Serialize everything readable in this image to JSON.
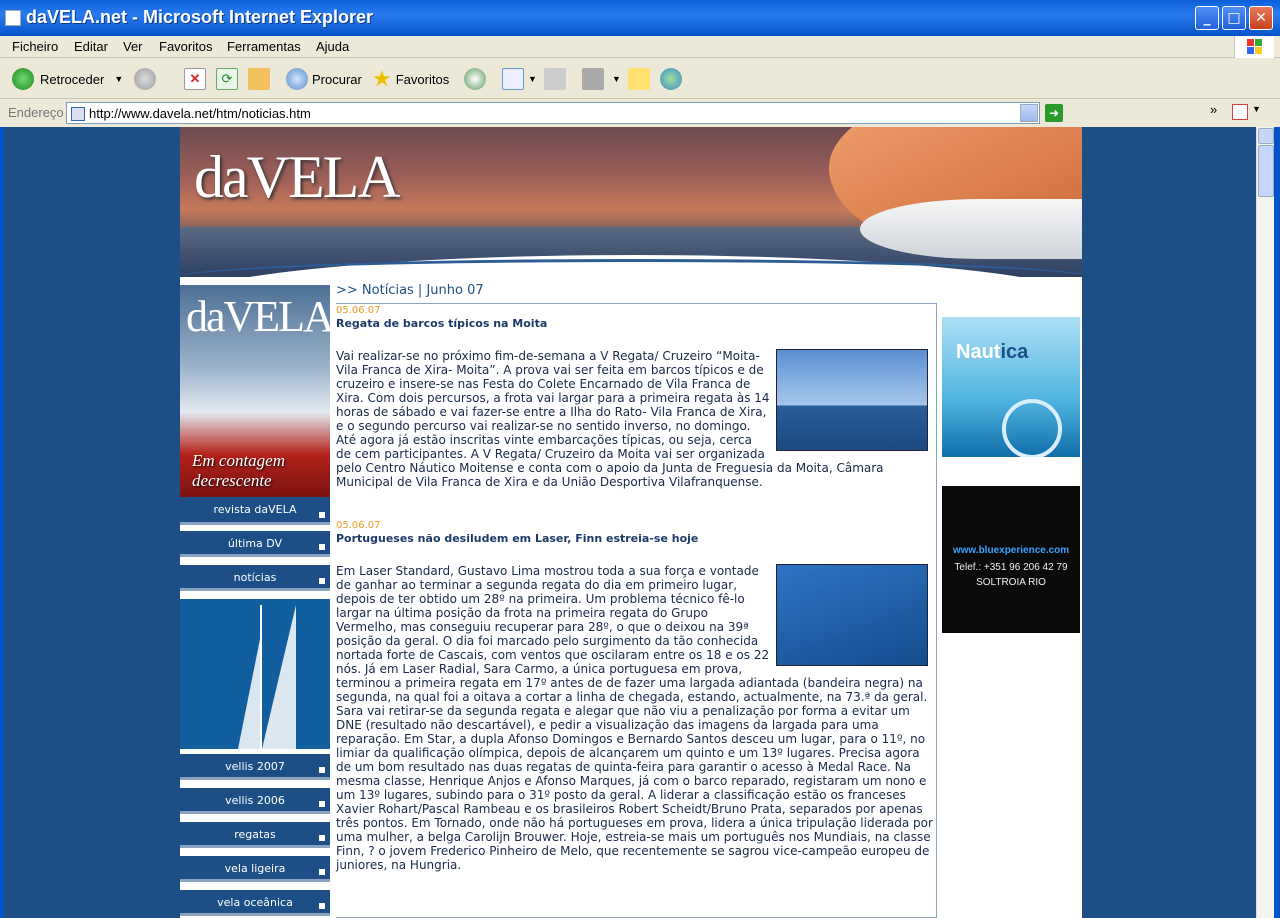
{
  "window": {
    "title": "daVELA.net - Microsoft Internet Explorer",
    "minimize": "_",
    "maximize": "□",
    "close": "✕"
  },
  "menu": [
    "Ficheiro",
    "Editar",
    "Ver",
    "Favoritos",
    "Ferramentas",
    "Ajuda"
  ],
  "toolbar": {
    "back": "Retroceder",
    "search": "Procurar",
    "favorites": "Favoritos"
  },
  "address": {
    "label": "Endereço",
    "url": "http://www.davela.net/htm/noticias.htm"
  },
  "site": {
    "logo": "daVELA",
    "cover_logo": "daVELA",
    "cover_tagline": "Em contagem decrescente",
    "nav": [
      "revista daVELA",
      "última DV",
      "notícias",
      "vellis 2007",
      "vellis 2006",
      "regatas",
      "vela ligeira",
      "vela oceânica"
    ],
    "heading": ">> Notícias | Junho 07",
    "articles": [
      {
        "date": "05.06.07",
        "title": "Regata de barcos típicos na Moita",
        "body": "Vai realizar-se no próximo fim-de-semana a V Regata/ Cruzeiro “Moita- Vila Franca de Xira- Moita”. A prova vai ser feita em barcos típicos e de cruzeiro e insere-se nas Festa do Colete Encarnado de Vila Franca de Xira. Com dois percursos, a frota vai largar para a primeira regata às 14 horas de sábado e vai fazer-se entre a Ilha do Rato- Vila Franca de Xira, e o segundo percurso vai realizar-se no sentido inverso, no domingo. Até agora já estão inscritas vinte embarcações típicas, ou seja, cerca de cem participantes. A V Regata/ Cruzeiro da Moita vai ser organizada pelo Centro Náutico Moitense e conta com o apoio da Junta de Freguesia da Moita, Câmara Municipal de Vila Franca de Xira e da União Desportiva Vilafranquense."
      },
      {
        "date": "05.06.07",
        "title": "Portugueses não desiludem em Laser, Finn estreia-se hoje",
        "body": "Em Laser Standard, Gustavo Lima mostrou toda a sua força e vontade de ganhar ao terminar a segunda regata do dia em primeiro lugar, depois de ter obtido um 28º na primeira. Um problema técnico fê-lo largar na última posição da frota na primeira regata do Grupo Vermelho, mas conseguiu recuperar para 28º, o que o deixou na 39ª posição da geral. O dia foi marcado pelo surgimento da tão conhecida nortada forte de Cascais, com ventos que oscilaram entre os 18 e os 22 nós. Já em Laser Radial, Sara Carmo, a única portuguesa em prova, terminou a primeira regata em 17º antes de de fazer uma largada adiantada (bandeira negra) na segunda, na qual foi a oitava a cortar a linha de chegada, estando, actualmente, na 73.ª da geral. Sara vai retirar-se da segunda regata e alegar que não viu a penalização por forma a evitar um DNE (resultado não descartável), e pedir a visualização das imagens da largada para uma reparação. Em Star, a dupla Afonso Domingos e Bernardo Santos desceu um lugar, para o 11º, no limiar da qualificação olímpica, depois de alcançarem um quinto e um 13º lugares. Precisa agora de um bom resultado nas duas regatas de quinta-feira para garantir o acesso à Medal Race. Na mesma classe, Henrique Anjos e Afonso Marques, já com o barco reparado, registaram um nono e um 13º lugares, subindo para o 31º posto da geral. A liderar a classificação estão os franceses Xavier Rohart/Pascal Rambeau e os brasileiros Robert Scheidt/Bruno Prata, separados por apenas três pontos. Em Tornado, onde não há portugueses em prova, lidera a única tripulação liderada por uma mulher, a belga Carolijn Brouwer. Hoje, estreia-se mais um português nos Mundiais, na classe Finn, ? o jovem Frederico Pinheiro de Melo, que recentemente se sagrou vice-campeão europeu de juniores, na Hungria."
      }
    ],
    "ads": {
      "nautica": {
        "brand_a": "Naut",
        "brand_b": "ica"
      },
      "blue": {
        "url": "www.bluexperience.com",
        "tel": "Telef.: +351 96 206 42 79",
        "loc": "SOLTROIA RIO"
      }
    }
  }
}
